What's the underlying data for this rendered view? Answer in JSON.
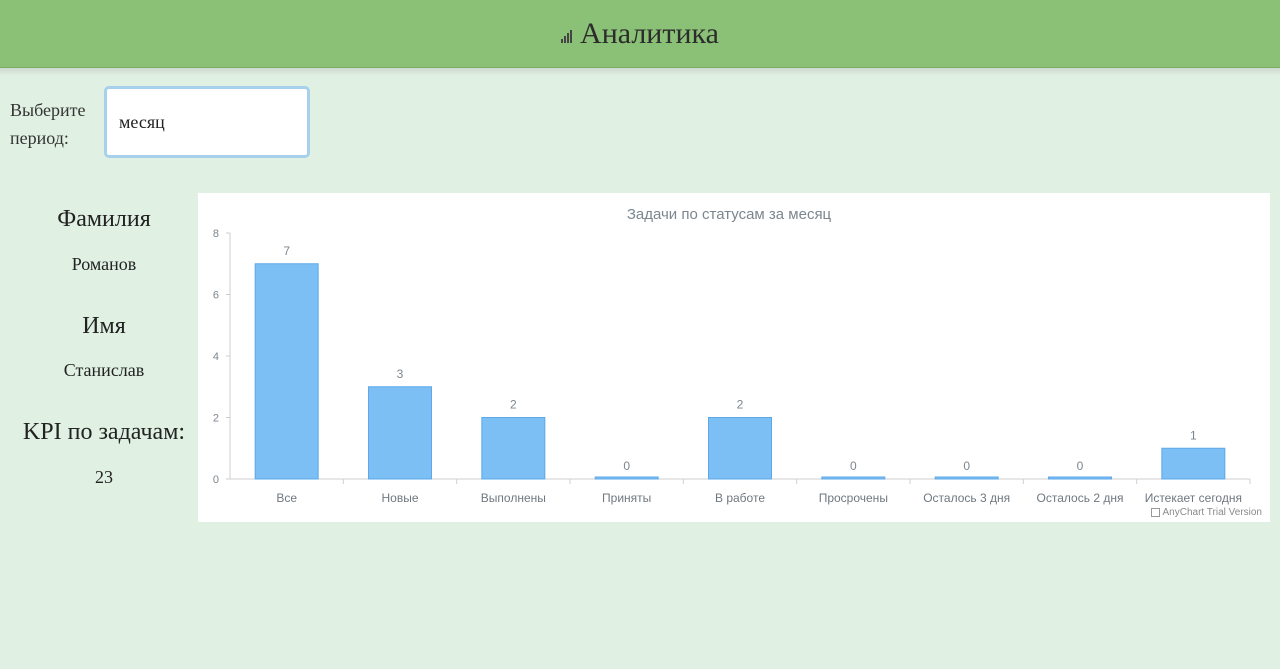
{
  "header": {
    "title": "Аналитика",
    "icon": "bar-chart-icon"
  },
  "period": {
    "label": "Выберите период:",
    "selected": "месяц"
  },
  "profile": {
    "surname_label": "Фамилия",
    "surname": "Романов",
    "name_label": "Имя",
    "name": "Станислав",
    "kpi_label": "KPI по задачам:",
    "kpi": "23"
  },
  "colors": {
    "header_bg": "#8bc176",
    "page_bg": "#e0f1e3",
    "bar": "#7cbff5",
    "bar_stroke": "#5ea8e8"
  },
  "watermark": "AnyChart Trial Version",
  "chart_data": {
    "type": "bar",
    "title": "Задачи по статусам за месяц",
    "categories": [
      "Все",
      "Новые",
      "Выполнены",
      "Приняты",
      "В работе",
      "Просрочены",
      "Осталось 3 дня",
      "Осталось 2 дня",
      "Истекает сегодня"
    ],
    "values": [
      7,
      3,
      2,
      0,
      2,
      0,
      0,
      0,
      1
    ],
    "ylim": [
      0,
      8
    ],
    "yticks": [
      0,
      2,
      4,
      6,
      8
    ],
    "xlabel": "",
    "ylabel": "",
    "data_labels": true,
    "grid": false
  }
}
